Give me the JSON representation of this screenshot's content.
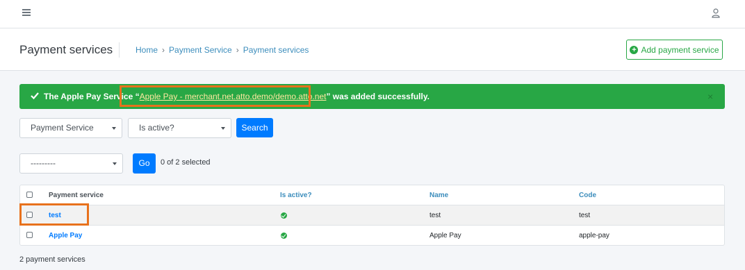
{
  "topbar": {
    "menu_icon": "hamburger-icon",
    "user_icon": "user-icon"
  },
  "header": {
    "title": "Payment services",
    "breadcrumb": [
      "Home",
      "Payment Service",
      "Payment services"
    ],
    "breadcrumb_separator": "›",
    "add_button_label": "Add payment service",
    "add_button_icon": "plus-circle-icon"
  },
  "alert": {
    "prefix": "The Apple Pay Service “",
    "link_text": "Apple Pay - merchant.net.atto.demo/demo.atto.net",
    "suffix": "” was added successfully.",
    "close": "×",
    "color": "#28a745"
  },
  "filters": {
    "payment_service": "Payment Service",
    "is_active": "Is active?",
    "search_button": "Search"
  },
  "actions": {
    "action_select": "---------",
    "go_button": "Go",
    "selected_count": "0 of 2 selected"
  },
  "table": {
    "headers": [
      "Payment service",
      "Is active?",
      "Name",
      "Code"
    ],
    "rows": [
      {
        "payment_service": "test",
        "is_active": true,
        "name": "test",
        "code": "test"
      },
      {
        "payment_service": "Apple Pay",
        "is_active": true,
        "name": "Apple Pay",
        "code": "apple-pay"
      }
    ]
  },
  "footer": {
    "count": "2 payment services"
  },
  "colors": {
    "accent": "#007bff",
    "success": "#28a745",
    "highlight": "#e8711c",
    "link": "#3c8dbc"
  }
}
